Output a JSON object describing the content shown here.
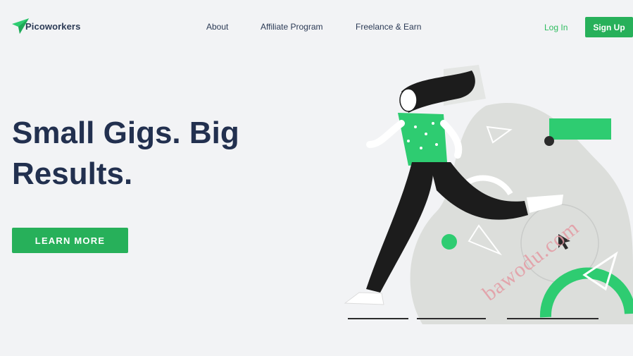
{
  "brand": {
    "name": "Picoworkers",
    "accent": "#27b05a",
    "logo_icon": "paper-plane-icon"
  },
  "nav": {
    "items": [
      {
        "label": "About"
      },
      {
        "label": "Affiliate Program"
      },
      {
        "label": "Freelance & Earn"
      }
    ],
    "login_label": "Log In",
    "signup_label": "Sign Up"
  },
  "hero": {
    "title": "Small Gigs. Big Results.",
    "cta_label": "LEARN MORE",
    "illustration": "running-woman-illustration"
  },
  "watermark": "bawodu.com",
  "colors": {
    "text": "#22304f",
    "background": "#f2f3f5",
    "green": "#27b05a"
  }
}
